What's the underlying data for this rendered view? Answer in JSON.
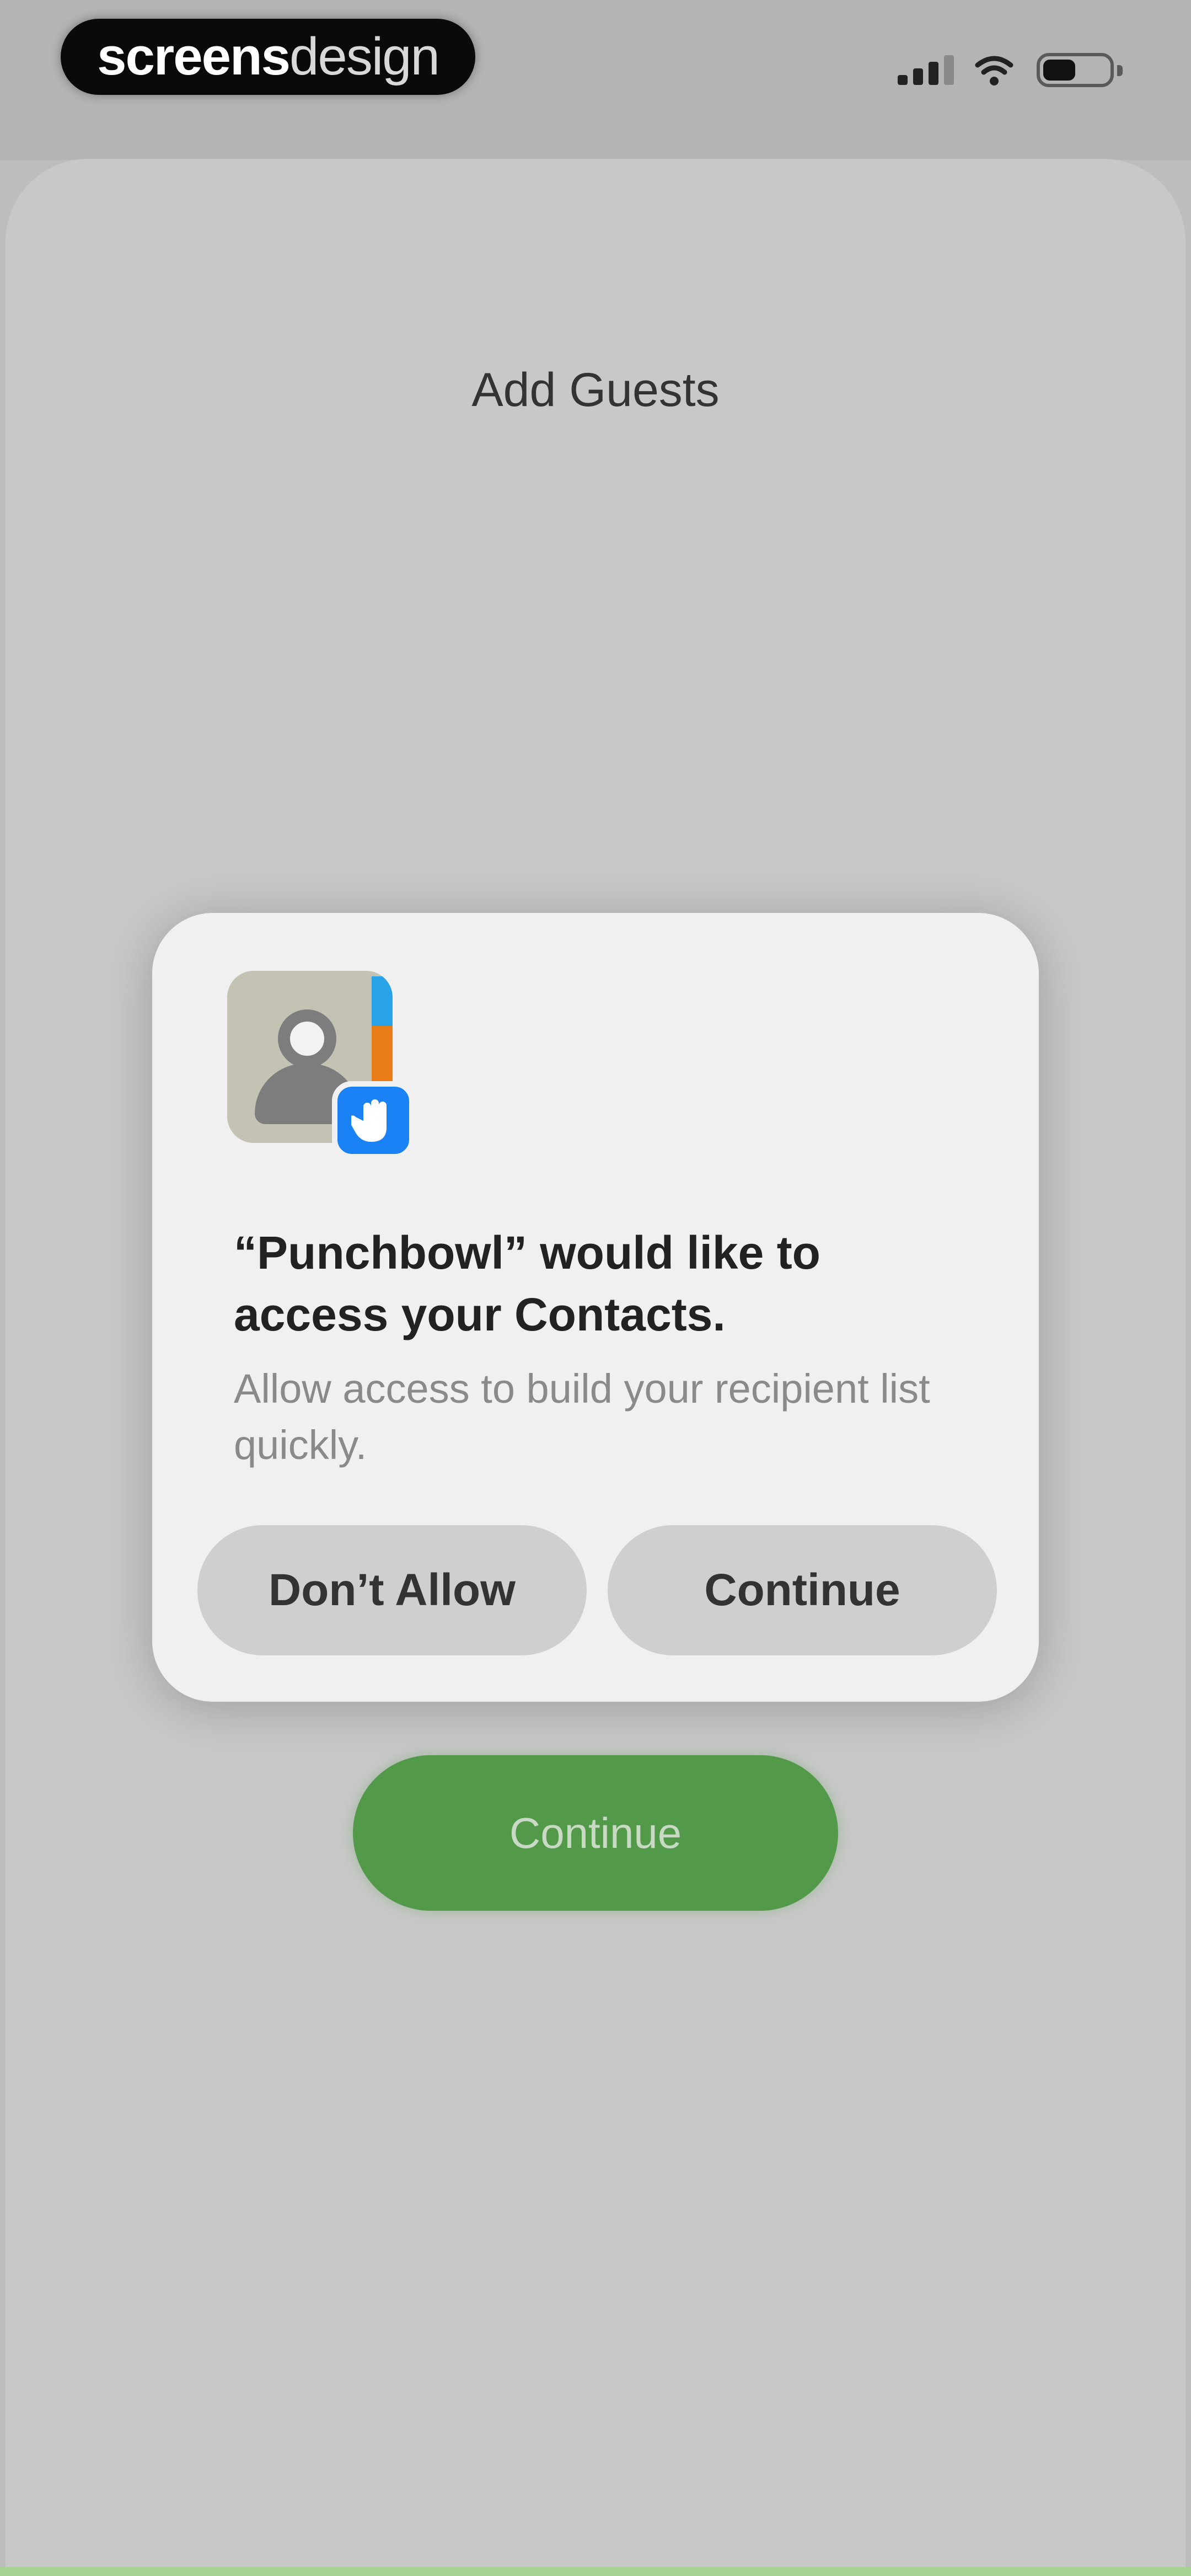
{
  "status_bar": {
    "brand_strong": "screens",
    "brand_light": "design",
    "icons": [
      "signal-icon",
      "wifi-icon",
      "battery-icon"
    ]
  },
  "sheet": {
    "title": "Add Guests",
    "continue_label": "Continue"
  },
  "dialog": {
    "app_icon": "contacts-icon",
    "badge_icon": "hand-icon",
    "title": "“Punchbowl” would like to access your Contacts.",
    "message": "Allow access to build your recipient list quickly.",
    "deny_label": "Don’t Allow",
    "allow_label": "Continue"
  },
  "colors": {
    "accent_green": "#529a4a",
    "badge_blue": "#1a82f5",
    "dialog_bg": "#f0f0f0"
  }
}
